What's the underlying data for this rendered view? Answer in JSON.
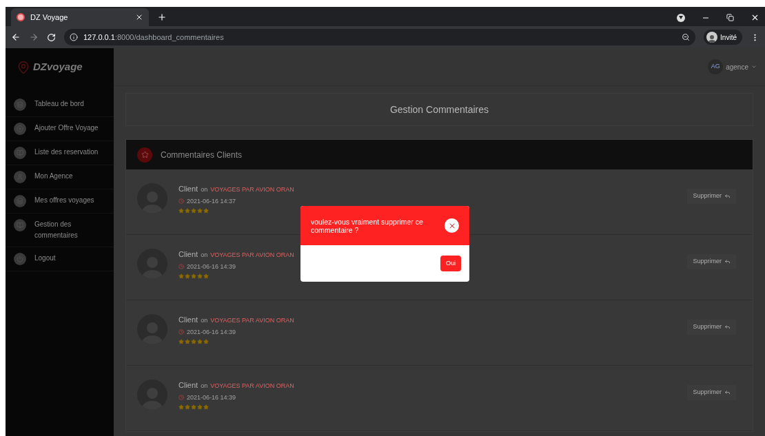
{
  "browser": {
    "tab_title": "DZ Voyage",
    "url_host": "127.0.0.1",
    "url_path": ":8000/dashboard_commentaires",
    "profile": "Invité"
  },
  "sidebar": {
    "logo": "DZvoyage",
    "items": [
      {
        "label": "Tableau de bord",
        "kind": "layers"
      },
      {
        "label": "Ajouter Offre Voyage",
        "kind": "plus"
      },
      {
        "label": "Liste des reservation",
        "kind": "book"
      },
      {
        "label": "Mon Agence",
        "kind": "user"
      },
      {
        "label": "Mes offres voyages",
        "kind": "layers"
      },
      {
        "label": "Gestion des commentaires",
        "kind": "book"
      },
      {
        "label": "Logout",
        "kind": "power"
      }
    ]
  },
  "topbar": {
    "avatar": "AG",
    "user": "agence"
  },
  "page_title": "Gestion Commentaires",
  "comments_panel": {
    "title": "Commentaires Clients",
    "comments": [
      {
        "author": "Client",
        "on": "on",
        "offer": "VOYAGES PAR AVION ORAN",
        "date": "2021-06-16 14:37",
        "stars": 5,
        "action": "Supprimer"
      },
      {
        "author": "Client",
        "on": "on",
        "offer": "VOYAGES PAR AVION ORAN",
        "date": "2021-06-16 14:39",
        "stars": 5,
        "action": "Supprimer"
      },
      {
        "author": "Client",
        "on": "on",
        "offer": "VOYAGES PAR AVION ORAN",
        "date": "2021-06-16 14:39",
        "stars": 5,
        "action": "Supprimer"
      },
      {
        "author": "Client",
        "on": "on",
        "offer": "VOYAGES PAR AVION ORAN",
        "date": "2021-06-16 14:39",
        "stars": 5,
        "action": "Supprimer"
      }
    ]
  },
  "dialog": {
    "message": "voulez-vous vraiment supprimer ce commentaire ?",
    "confirm": "Oui"
  }
}
